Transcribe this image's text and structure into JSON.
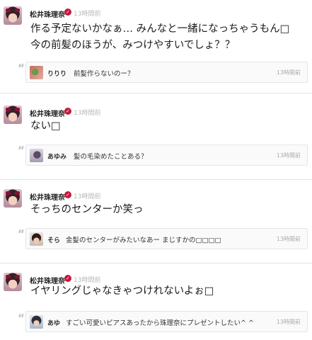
{
  "posts": [
    {
      "author": "松井珠理奈",
      "time": "13時間前",
      "lines": [
        "作る予定ないかなぁ… みんなと一緒になっちゃうもん□",
        "今の前髪のほうが、みつけやすいでしょ？？"
      ],
      "reply": {
        "name": "りりり",
        "text": "前髪作らないのー？",
        "time": "13時間前"
      }
    },
    {
      "author": "松井珠理奈",
      "time": "13時間前",
      "lines": [
        "ない□"
      ],
      "reply": {
        "name": "あゆみ",
        "text": "髪の毛染めたことある？",
        "time": "13時間前"
      }
    },
    {
      "author": "松井珠理奈",
      "time": "13時間前",
      "lines": [
        "そっちのセンターか笑っ"
      ],
      "reply": {
        "name": "そら",
        "text": "金髪のセンターがみたいなあー まじすかの□□□□",
        "time": "13時間前"
      }
    },
    {
      "author": "松井珠理奈",
      "time": "13時間前",
      "lines": [
        "イヤリングじゃなきゃつけれないよぉ□"
      ],
      "reply": {
        "name": "あゆ",
        "text": "すごい可愛いピアスあったから珠理奈にプレゼントしたい^ ^",
        "time": "13時間前"
      }
    }
  ],
  "colors": {
    "badge": "#c4183c",
    "time": "#b8b8b8",
    "separator": "#e2e2e2"
  },
  "icons": {
    "verified": "check-badge-icon",
    "quote": "quote-mark-icon"
  }
}
